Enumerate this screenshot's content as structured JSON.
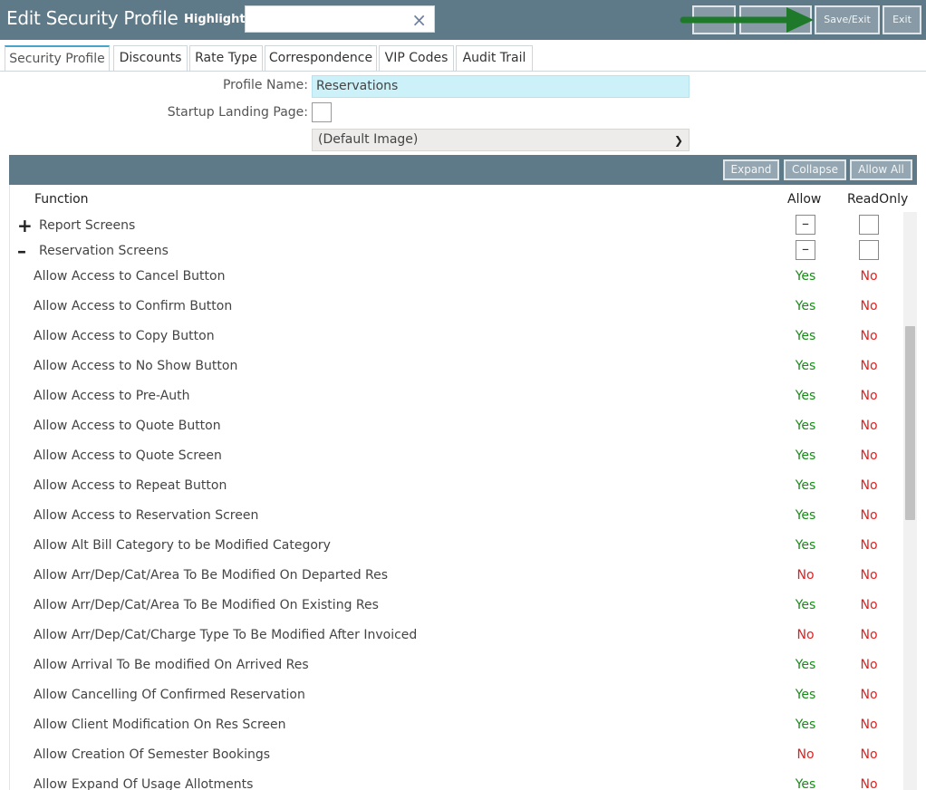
{
  "header": {
    "title": "Edit Security Profile",
    "highlight_label": "Highlight:",
    "highlight_value": "",
    "clear_glyph": "×",
    "buttons": [
      "",
      "",
      "Save/Exit",
      "Exit"
    ]
  },
  "tabs": [
    "Security Profile",
    "Discounts",
    "Rate Type",
    "Correspondence",
    "VIP Codes",
    "Audit Trail"
  ],
  "form": {
    "profile_name_label": "Profile Name:",
    "profile_name_value": "Reservations",
    "startup_label": "Startup Landing Page:",
    "image_select": "(Default Image)"
  },
  "toolbar": {
    "expand": "Expand",
    "collapse": "Collapse",
    "allow_all": "Allow All"
  },
  "grid": {
    "col_function": "Function",
    "col_allow": "Allow",
    "col_readonly": "ReadOnly",
    "groups": [
      {
        "sign": "+",
        "label": "Report Screens",
        "allow_box": "–",
        "readonly_box": ""
      },
      {
        "sign": "–",
        "label": "Reservation Screens",
        "allow_box": "–",
        "readonly_box": ""
      }
    ],
    "rows": [
      {
        "fn": "Allow Access to Cancel Button",
        "allow": "Yes",
        "readonly": "No"
      },
      {
        "fn": "Allow Access to Confirm Button",
        "allow": "Yes",
        "readonly": "No"
      },
      {
        "fn": "Allow Access to Copy Button",
        "allow": "Yes",
        "readonly": "No"
      },
      {
        "fn": "Allow Access to No Show Button",
        "allow": "Yes",
        "readonly": "No"
      },
      {
        "fn": "Allow Access to Pre-Auth",
        "allow": "Yes",
        "readonly": "No"
      },
      {
        "fn": "Allow Access to Quote Button",
        "allow": "Yes",
        "readonly": "No"
      },
      {
        "fn": "Allow Access to Quote Screen",
        "allow": "Yes",
        "readonly": "No"
      },
      {
        "fn": "Allow Access to Repeat Button",
        "allow": "Yes",
        "readonly": "No"
      },
      {
        "fn": "Allow Access to Reservation Screen",
        "allow": "Yes",
        "readonly": "No"
      },
      {
        "fn": "Allow Alt Bill Category to be Modified Category",
        "allow": "Yes",
        "readonly": "No"
      },
      {
        "fn": "Allow Arr/Dep/Cat/Area To Be Modified On Departed Res",
        "allow": "No",
        "readonly": "No"
      },
      {
        "fn": "Allow Arr/Dep/Cat/Area To Be Modified On Existing Res",
        "allow": "Yes",
        "readonly": "No"
      },
      {
        "fn": "Allow Arr/Dep/Cat/Charge Type To Be Modified After Invoiced",
        "allow": "No",
        "readonly": "No"
      },
      {
        "fn": "Allow Arrival To Be modified On Arrived Res",
        "allow": "Yes",
        "readonly": "No"
      },
      {
        "fn": "Allow Cancelling Of Confirmed Reservation",
        "allow": "Yes",
        "readonly": "No"
      },
      {
        "fn": "Allow Client Modification On Res Screen",
        "allow": "Yes",
        "readonly": "No"
      },
      {
        "fn": "Allow Creation Of Semester Bookings",
        "allow": "No",
        "readonly": "No"
      },
      {
        "fn": "Allow Expand Of Usage Allotments",
        "allow": "Yes",
        "readonly": "No"
      }
    ]
  },
  "colors": {
    "header_bg": "#5e7988",
    "yes": "#1a8a1a",
    "no": "#e02020",
    "profile_input_bg": "#ccf1f9",
    "arrow": "#1e7a2a"
  }
}
